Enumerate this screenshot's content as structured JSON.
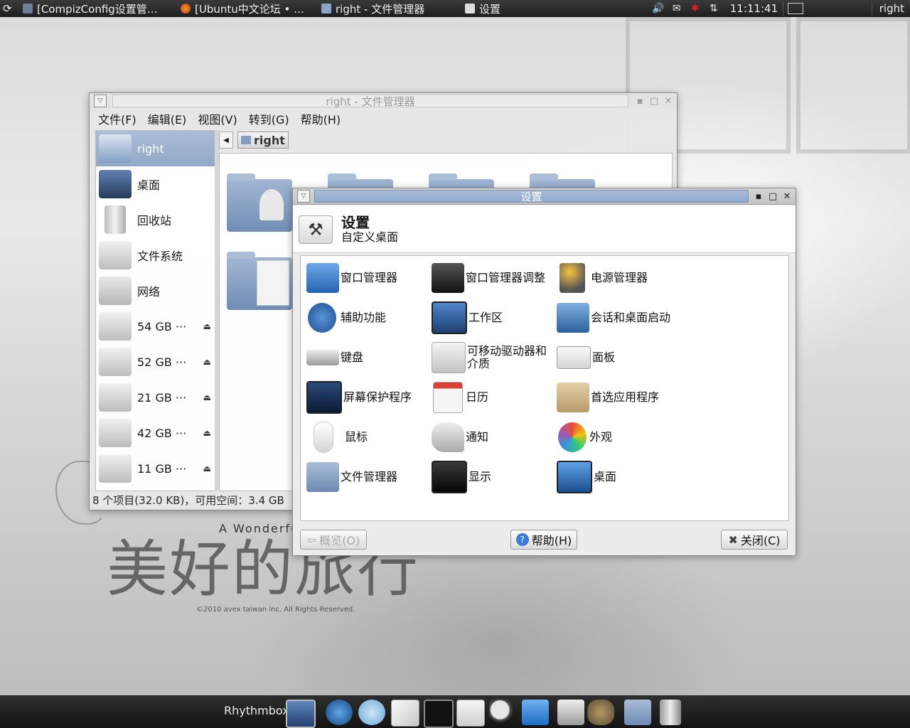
{
  "top_panel": {
    "tasks": [
      {
        "label": "[CompizConfig设置管…",
        "icon": "compiz-icon"
      },
      {
        "label": "[Ubuntu中文论坛 • …",
        "icon": "firefox-icon"
      },
      {
        "label": "right - 文件管理器",
        "icon": "folder-icon"
      },
      {
        "label": "设置",
        "icon": "settings-icon"
      }
    ],
    "clock": "11:11:41",
    "user": "right"
  },
  "file_manager": {
    "title": "right - 文件管理器",
    "menu": [
      "文件(F)",
      "编辑(E)",
      "视图(V)",
      "转到(G)",
      "帮助(H)"
    ],
    "sidebar": [
      {
        "label": "right",
        "icon": "home-icon",
        "selected": true
      },
      {
        "label": "桌面",
        "icon": "desktop-icon"
      },
      {
        "label": "回收站",
        "icon": "trash-icon"
      },
      {
        "label": "文件系统",
        "icon": "harddisk-icon"
      },
      {
        "label": "网络",
        "icon": "network-icon"
      },
      {
        "label": "54 GB ···",
        "icon": "harddisk-icon",
        "eject": true
      },
      {
        "label": "52 GB ···",
        "icon": "harddisk-icon",
        "eject": true
      },
      {
        "label": "21 GB ···",
        "icon": "harddisk-icon",
        "eject": true
      },
      {
        "label": "42 GB ···",
        "icon": "harddisk-icon",
        "eject": true
      },
      {
        "label": "11 GB ···",
        "icon": "harddisk-icon",
        "eject": true
      }
    ],
    "path": "right",
    "status": "8 个项目(32.0 KB)，可用空间：3.4 GB"
  },
  "settings": {
    "title": "设置",
    "header_title": "设置",
    "header_subtitle": "自定义桌面",
    "items": [
      {
        "label": "窗口管理器",
        "icon": "window-manager-icon"
      },
      {
        "label": "窗口管理器调整",
        "icon": "wm-tweaks-icon"
      },
      {
        "label": "电源管理器",
        "icon": "power-manager-icon"
      },
      {
        "label": "辅助功能",
        "icon": "accessibility-icon"
      },
      {
        "label": "工作区",
        "icon": "workspaces-icon"
      },
      {
        "label": "会话和桌面启动",
        "icon": "session-startup-icon"
      },
      {
        "label": "键盘",
        "icon": "keyboard-icon"
      },
      {
        "label": "可移动驱动器和介质",
        "icon": "removable-drives-icon"
      },
      {
        "label": "面板",
        "icon": "panel-icon"
      },
      {
        "label": "屏幕保护程序",
        "icon": "screensaver-icon"
      },
      {
        "label": "日历",
        "icon": "calendar-icon"
      },
      {
        "label": "首选应用程序",
        "icon": "preferred-apps-icon"
      },
      {
        "label": "鼠标",
        "icon": "mouse-icon"
      },
      {
        "label": "通知",
        "icon": "notifications-icon"
      },
      {
        "label": "外观",
        "icon": "appearance-icon"
      },
      {
        "label": "文件管理器",
        "icon": "file-manager-icon"
      },
      {
        "label": "显示",
        "icon": "display-icon"
      },
      {
        "label": "桌面",
        "icon": "desktop-settings-icon"
      }
    ],
    "buttons": {
      "overview": "概览(O)",
      "help": "帮助(H)",
      "close": "关闭(C)"
    }
  },
  "dock": {
    "label": "Rhythmbox",
    "icons": [
      "window-icon",
      "browser-icon",
      "swirl-icon",
      "mail-icon",
      "terminal-icon",
      "settings-icon",
      "search-icon",
      "download-icon",
      "editor-icon",
      "gimp-icon",
      "folder-icon",
      "trash-icon"
    ]
  },
  "wallpaper": {
    "caption_big": "美好的旅行",
    "caption_small": "A Wonderfu",
    "copyright": "©2010  avex taiwan inc. All Rights Reserved."
  }
}
